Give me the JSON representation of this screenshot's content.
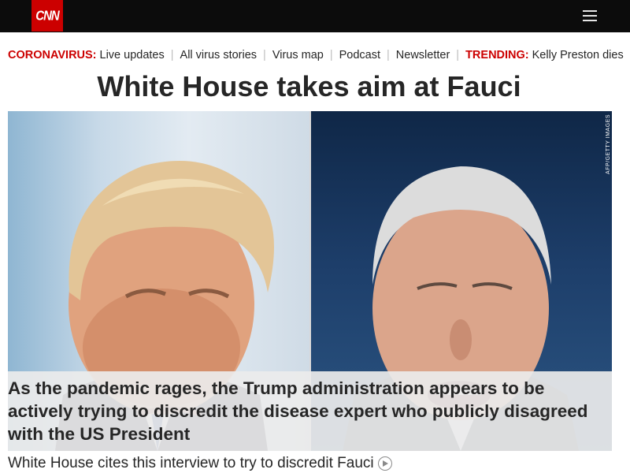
{
  "header": {
    "logo_text": "CNN",
    "menu_icon": "hamburger-menu-icon"
  },
  "nav": {
    "coronavirus_label": "CORONAVIRUS:",
    "links": [
      "Live updates",
      "All virus stories",
      "Virus map",
      "Podcast",
      "Newsletter"
    ],
    "trending_label": "TRENDING:",
    "trending_item": "Kelly Preston dies"
  },
  "article": {
    "headline": "White House takes aim at Fauci",
    "image_credit": "AFP/GETTY IMAGES",
    "caption": "As the pandemic rages, the Trump administration appears to be actively trying to discredit the disease expert who publicly disagreed with the US President",
    "video_link": "White House cites this interview to try to discredit Fauci",
    "video_icon": "play-circle-icon"
  },
  "colors": {
    "brand_red": "#cc0000",
    "topbar": "#0c0c0c",
    "text": "#262626"
  }
}
